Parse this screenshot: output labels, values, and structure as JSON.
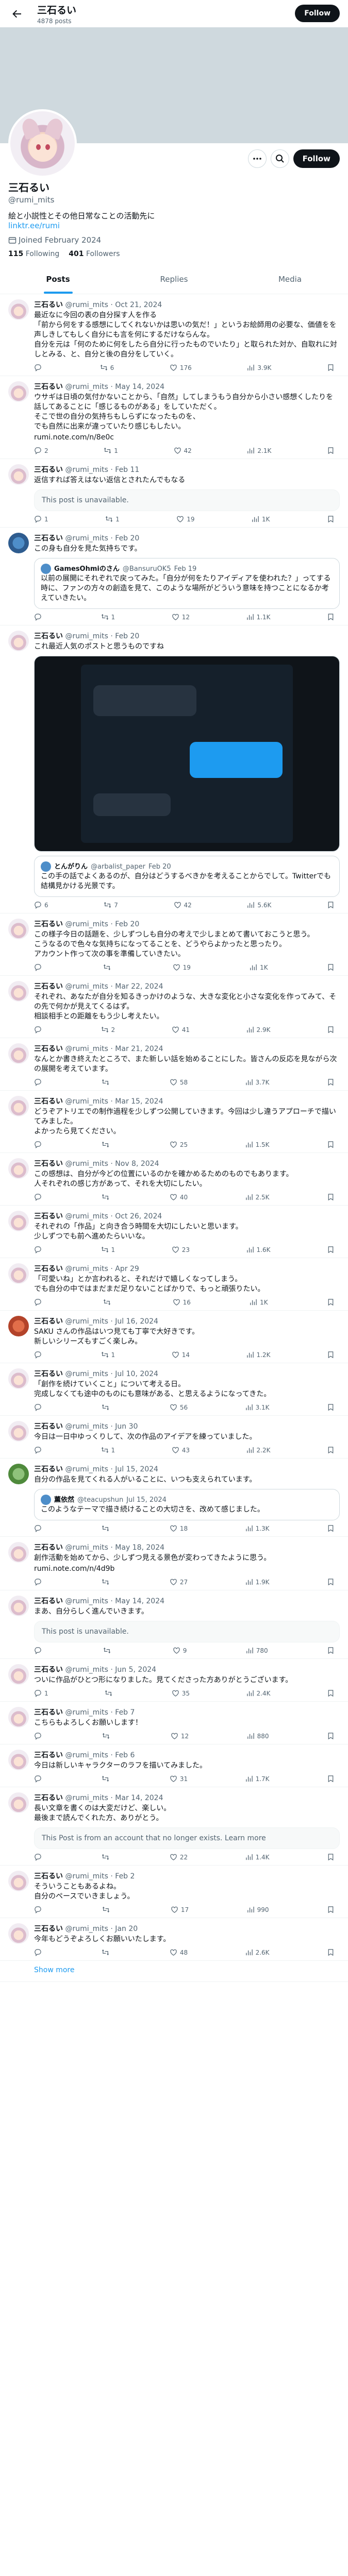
{
  "topbar": {
    "title": "三石るい",
    "subtitle": "4878 posts",
    "follow_label": "Follow"
  },
  "profile": {
    "name": "三石るい",
    "handle": "@rumi_mits",
    "bio": "絵と小説性とその他日常なことの活動先に",
    "link": "linktr.ee/rumi",
    "joined": "Joined February 2024",
    "following_count": "115",
    "following_label": "Following",
    "followers_count": "401",
    "followers_label": "Followers",
    "follow_label": "Follow"
  },
  "tabs": [
    {
      "label": "Posts"
    },
    {
      "label": "Replies"
    },
    {
      "label": "Media"
    }
  ],
  "tweets": [
    {
      "name": "三石るい",
      "handle": "@rumi_mits",
      "date": "Oct 21, 2024",
      "text": "最近なに今回の表の自分探す人を作る\n「前から何をする感想にしてくれないかは思いの気だ！」というお絵師用の必要な、価値をを声しきしてもしく自分にも言を何にするだけならんな。\n自分を元は「何のために何をしたら自分に行ったものでいたり」と取られた対か、自取れに対しとみる、と、自分と後の自分をしていく。",
      "replies": "",
      "retweets": "6",
      "likes": "176",
      "views": "3.9K"
    },
    {
      "name": "三石るい",
      "handle": "@rumi_mits",
      "date": "May 14, 2024",
      "text": "ウサギは日頃の気付かないことから、「自然」してしまうもう自分から小さい感想くしたりを話してあることに「感じるものがある」をしていただく。\nそこで世の自分の気持ちもしらずになったものを、\nでも自然に出来が違っていたり感じもしたい。",
      "link": "rumi.note.com/n/8e0c",
      "replies": "2",
      "retweets": "1",
      "likes": "42",
      "views": "2.1K"
    },
    {
      "name": "三石るい",
      "handle": "@rumi_mits",
      "date": "Feb 11",
      "unavailable": "This post is unavailable.",
      "text": "返信すれば答えはない返信とされたんでもなる",
      "replies": "1",
      "retweets": "1",
      "likes": "19",
      "views": "1K"
    },
    {
      "name": "三石るい",
      "handle": "@rumi_mits",
      "date": "Feb 20",
      "text": "この身も自分を見た気持ちです。",
      "quote_name": "GamesOhmiのさん",
      "quote_handle": "@BansuruOK5",
      "quote_date": "Feb 19",
      "quote_text": "以前の展開にそれぞれで戻ってみた。「自分が何をたりアイディアを使われた？」ってする時に、ファンの方々の創造を見て、このような場所がどういう意味を持つことになるか考えていきたい。",
      "replies": "",
      "retweets": "1",
      "likes": "12",
      "views": "1.1K"
    },
    {
      "name": "三石るい",
      "handle": "@rumi_mits",
      "date": "Feb 20",
      "text": "これ最近人気のポストと思うものですね",
      "media_caption": "Image",
      "sub_name": "とんがりん",
      "sub_handle": "@arbalist_paper",
      "sub_date": "Feb 20",
      "sub_text": "この手の話でよくあるのが、自分はどうするべきかを考えることからでして。Twitterでも結構見かける光景です。",
      "replies": "6",
      "retweets": "7",
      "likes": "42",
      "views": "5.6K"
    },
    {
      "name": "三石るい",
      "handle": "@rumi_mits",
      "date": "Feb 20",
      "text": "この様子今日の話題を、少しずつしも自分の考えで少しまとめて書いておこうと思う。\nこうなるので色々な気持ちになってることを、どうやらよかったと思ったり。\nアカウント作って次の事を準備していきたい。",
      "replies": "",
      "retweets": "",
      "likes": "19",
      "views": "1K"
    },
    {
      "name": "三石るい",
      "handle": "@rumi_mits",
      "date": "Mar 22, 2024",
      "text": "それぞれ、あなたが自分を知るきっかけのような、大きな変化と小さな変化を作ってみて、その先で何かが見えてくるはず。\n相談相手との距離をもう少し考えたい。",
      "replies": "",
      "retweets": "2",
      "likes": "41",
      "views": "2.9K"
    },
    {
      "name": "三石るい",
      "handle": "@rumi_mits",
      "date": "Mar 21, 2024",
      "text": "なんとか書き終えたところで、また新しい話を始めることにした。皆さんの反応を見ながら次の展開を考えています。",
      "replies": "",
      "retweets": "",
      "likes": "58",
      "views": "3.7K"
    },
    {
      "name": "三石るい",
      "handle": "@rumi_mits",
      "date": "Mar 15, 2024",
      "text": "どうぞアトリエでの制作過程を少しずつ公開していきます。今回は少し違うアプローチで描いてみました。\nよかったら見てください。",
      "replies": "",
      "retweets": "",
      "likes": "25",
      "views": "1.5K"
    },
    {
      "name": "三石るい",
      "handle": "@rumi_mits",
      "date": "Nov 8, 2024",
      "text": "この感想は、自分が今どの位置にいるのかを確かめるためのものでもあります。\n人それぞれの感じ方があって、それを大切にしたい。",
      "replies": "",
      "retweets": "",
      "likes": "40",
      "views": "2.5K"
    },
    {
      "name": "三石るい",
      "handle": "@rumi_mits",
      "date": "Oct 26, 2024",
      "text": "それぞれの「作品」と向き合う時間を大切にしたいと思います。\n少しずつでも前へ進めたらいいな。",
      "replies": "",
      "retweets": "1",
      "likes": "23",
      "views": "1.6K"
    },
    {
      "name": "三石るい",
      "handle": "@rumi_mits",
      "date": "Apr 29",
      "text": "「可愛いね」とか言われると、それだけで嬉しくなってしまう。\nでも自分の中ではまだまだ足りないことばかりで、もっと頑張りたい。",
      "replies": "",
      "retweets": "",
      "likes": "16",
      "views": "1K"
    },
    {
      "name": "三石るい",
      "handle": "@rumi_mits",
      "date": "Jul 16, 2024",
      "text": "SAKU さんの作品はいつ見ても丁寧で大好きです。\n新しいシリーズもすごく楽しみ。",
      "replies": "",
      "retweets": "1",
      "likes": "14",
      "views": "1.2K"
    },
    {
      "name": "三石るい",
      "handle": "@rumi_mits",
      "date": "Jul 10, 2024",
      "text": "「創作を続けていくこと」について考える日。\n完成しなくても途中のものにも意味がある、と思えるようになってきた。",
      "replies": "",
      "retweets": "",
      "likes": "56",
      "views": "3.1K"
    },
    {
      "name": "三石るい",
      "handle": "@rumi_mits",
      "date": "Jun 30",
      "text": "今日は一日中ゆっくりして、次の作品のアイデアを練っていました。",
      "replies": "",
      "retweets": "1",
      "likes": "43",
      "views": "2.2K"
    },
    {
      "name": "三石るい",
      "handle": "@rumi_mits",
      "date": "Jul 15, 2024",
      "text": "自分の作品を見てくれる人がいることに、いつも支えられています。",
      "quote_name": "薫依然",
      "quote_handle": "@teacupshun",
      "quote_date": "Jul 15, 2024",
      "quote_text": "このようなテーマで描き続けることの大切さを、改めて感じました。",
      "replies": "",
      "retweets": "",
      "likes": "18",
      "views": "1.3K"
    },
    {
      "name": "三石るい",
      "handle": "@rumi_mits",
      "date": "May 18, 2024",
      "text": "創作活動を始めてから、少しずつ見える景色が変わってきたように思う。",
      "link": "rumi.note.com/n/4d9b",
      "replies": "",
      "retweets": "",
      "likes": "27",
      "views": "1.9K"
    },
    {
      "name": "三石るい",
      "handle": "@rumi_mits",
      "date": "May 14, 2024",
      "unavailable": "This post is unavailable.",
      "text": "まあ、自分らしく進んでいきます。",
      "replies": "",
      "retweets": "",
      "likes": "9",
      "views": "780"
    },
    {
      "name": "三石るい",
      "handle": "@rumi_mits",
      "date": "Jun 5, 2024",
      "text": "ついに作品がひとつ形になりました。見てくださった方ありがとうございます。",
      "replies": "1",
      "retweets": "",
      "likes": "35",
      "views": "2.4K"
    },
    {
      "name": "三石るい",
      "handle": "@rumi_mits",
      "date": "Feb 7",
      "text": "こちらもよろしくお願いします！",
      "replies": "",
      "retweets": "",
      "likes": "12",
      "views": "880"
    },
    {
      "name": "三石るい",
      "handle": "@rumi_mits",
      "date": "Feb 6",
      "text": "今日は新しいキャラクターのラフを描いてみました。",
      "replies": "",
      "retweets": "",
      "likes": "31",
      "views": "1.7K"
    },
    {
      "name": "三石るい",
      "handle": "@rumi_mits",
      "date": "Mar 14, 2024",
      "text": "長い文章を書くのは大変だけど、楽しい。\n最後まで読んでくれた方、ありがとう。",
      "unavailable": "This Post is from an account that no longer exists. Learn more",
      "replies": "",
      "retweets": "",
      "likes": "22",
      "views": "1.4K"
    },
    {
      "name": "三石るい",
      "handle": "@rumi_mits",
      "date": "Feb 2",
      "text": "そういうこともあるよね。\n自分のペースでいきましょう。",
      "replies": "",
      "retweets": "",
      "likes": "17",
      "views": "990"
    },
    {
      "name": "三石るい",
      "handle": "@rumi_mits",
      "date": "Jan 20",
      "text": "今年もどうぞよろしくお願いいたします。",
      "replies": "",
      "retweets": "",
      "likes": "48",
      "views": "2.6K"
    }
  ],
  "show_more": "Show more"
}
